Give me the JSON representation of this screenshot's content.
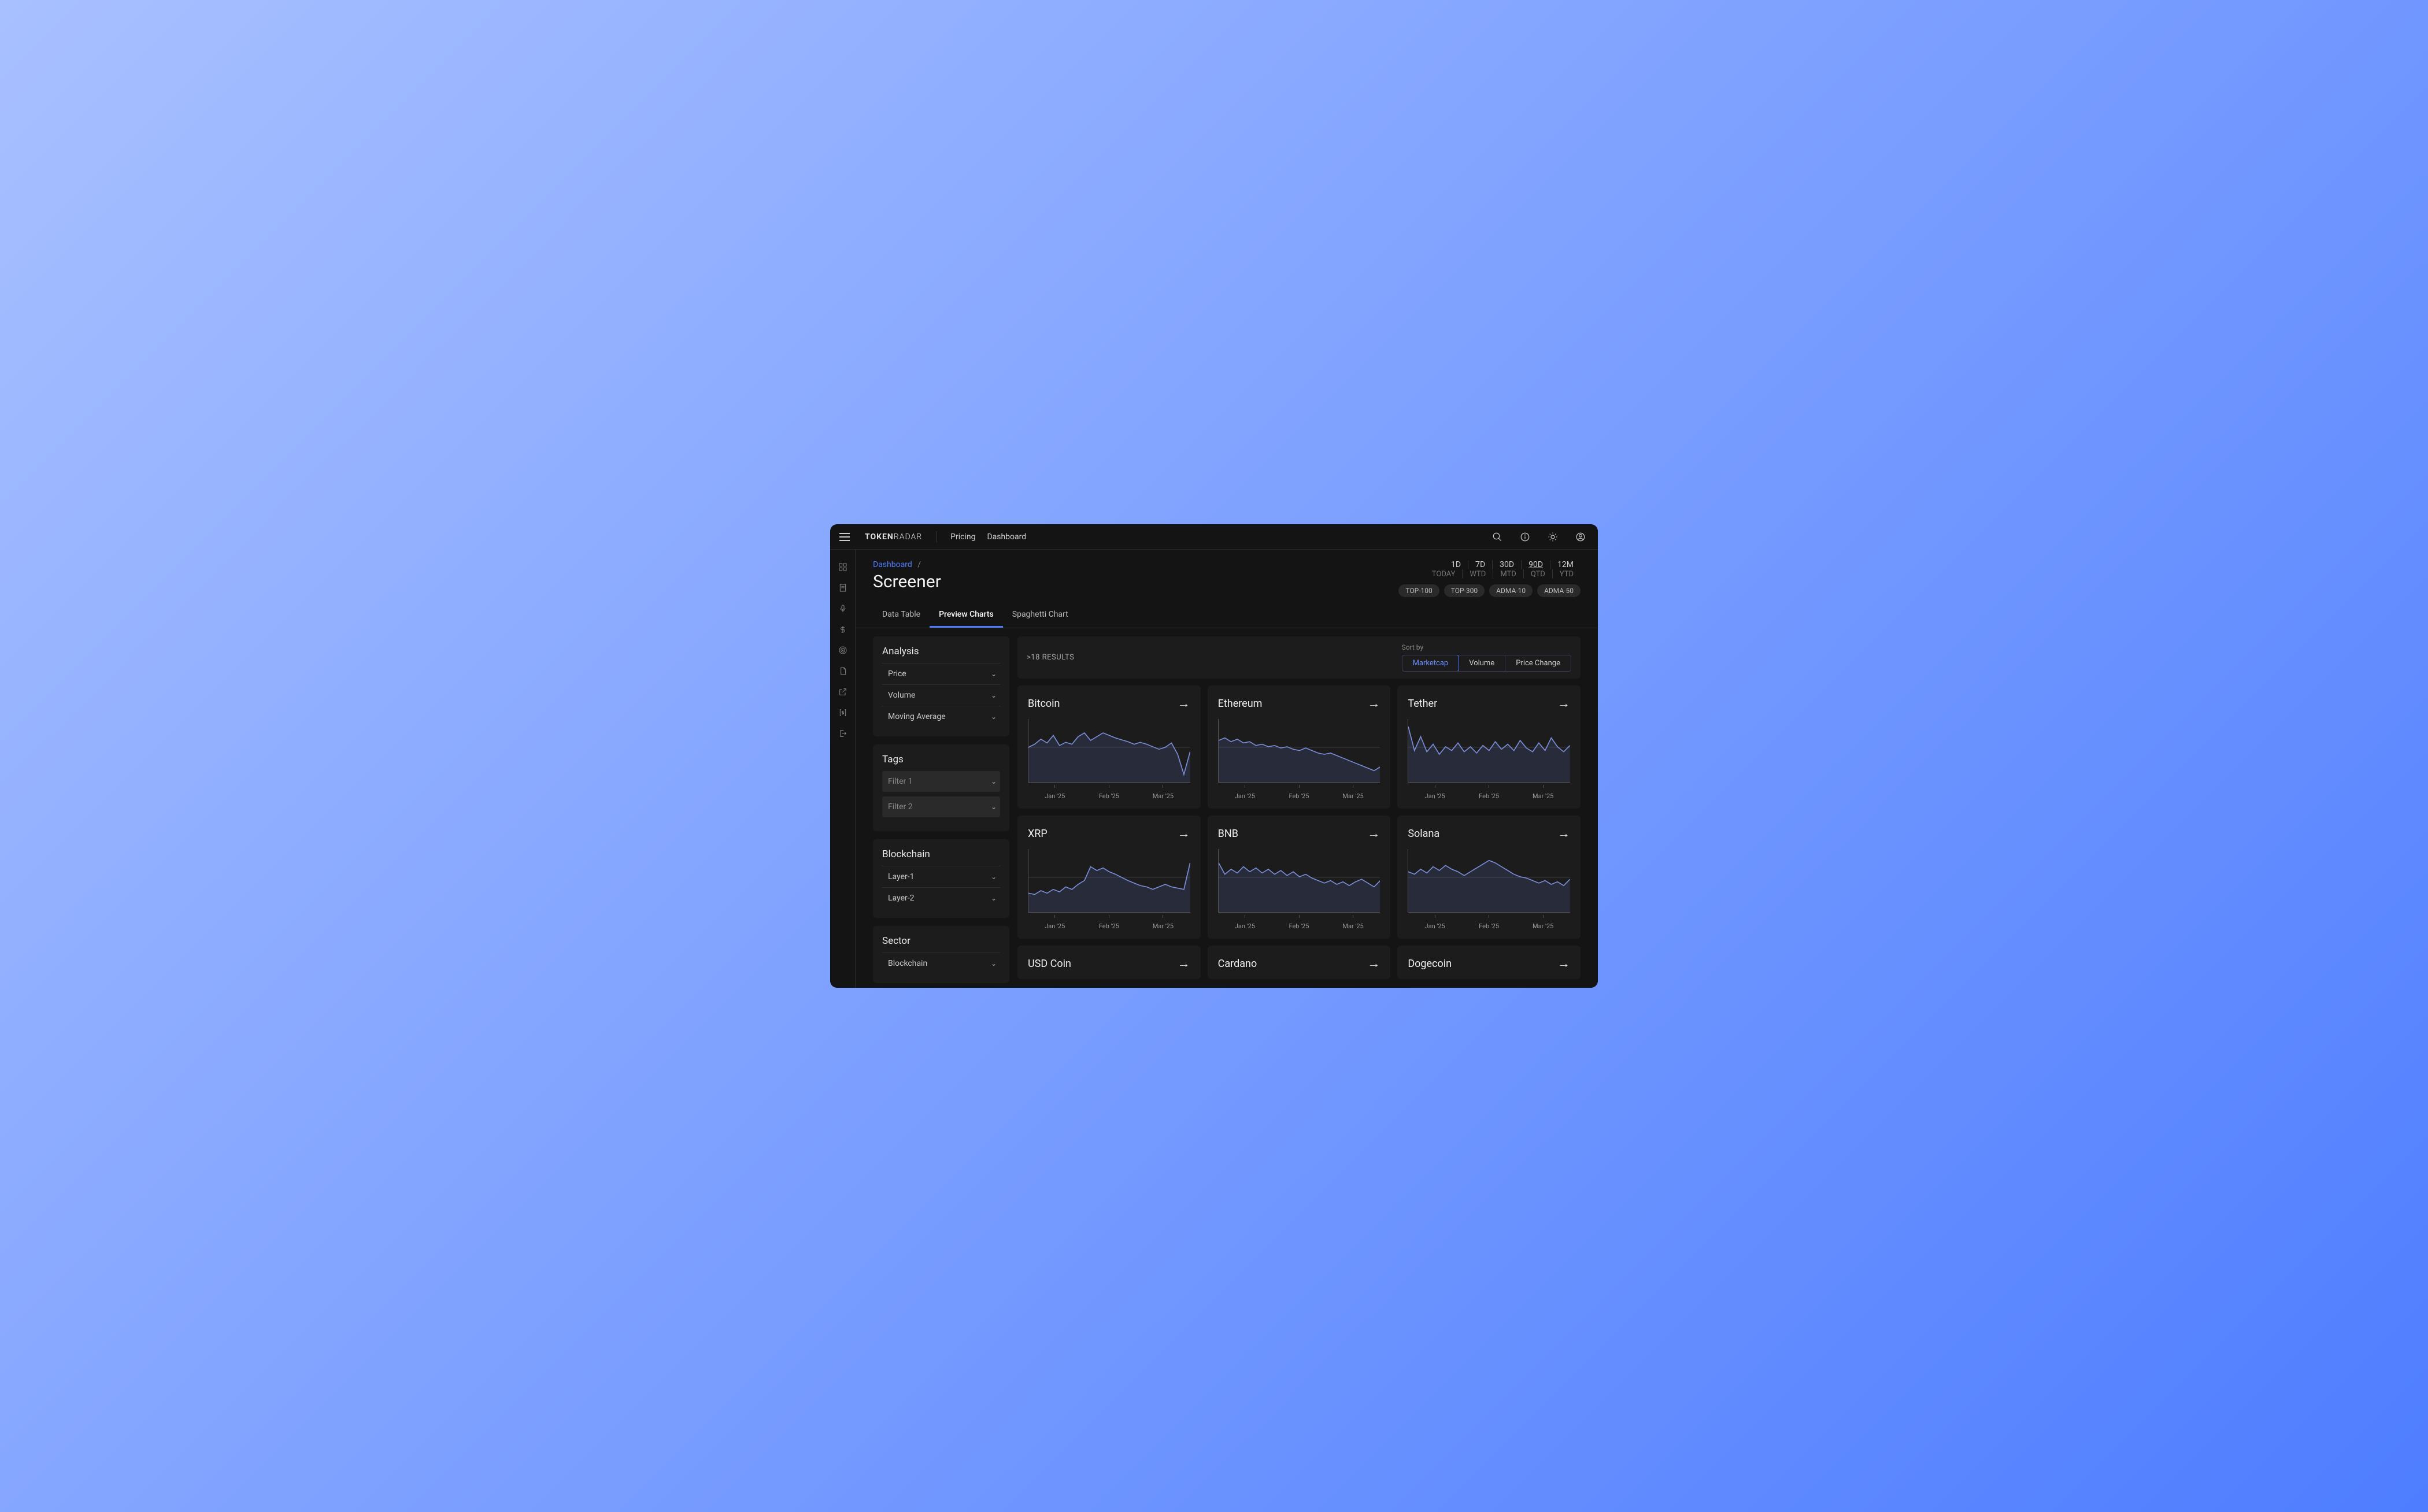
{
  "brand": {
    "strong": "TOKEN",
    "light": "RADAR"
  },
  "nav": {
    "pricing": "Pricing",
    "dashboard": "Dashboard"
  },
  "breadcrumb": {
    "root": "Dashboard",
    "sep": "/"
  },
  "page_title": "Screener",
  "tabs": {
    "data_table": "Data Table",
    "preview_charts": "Preview Charts",
    "spaghetti": "Spaghetti Chart"
  },
  "timeframe_top": [
    "1D",
    "7D",
    "30D",
    "90D",
    "12M"
  ],
  "timeframe_bottom": [
    "TODAY",
    "WTD",
    "MTD",
    "QTD",
    "YTD"
  ],
  "timeframe_active_index": 3,
  "index_chips": [
    "TOP-100",
    "TOP-300",
    "ADMA-10",
    "ADMA-50"
  ],
  "panels": {
    "analysis": {
      "title": "Analysis",
      "items": [
        "Price",
        "Volume",
        "Moving Average"
      ]
    },
    "tags": {
      "title": "Tags",
      "items": [
        "Filter 1",
        "Filter 2"
      ]
    },
    "blockchain": {
      "title": "Blockchain",
      "items": [
        "Layer-1",
        "Layer-2"
      ]
    },
    "sector": {
      "title": "Sector",
      "items": [
        "Blockchain"
      ]
    }
  },
  "results_count": ">18 RESULTS",
  "sort": {
    "label": "Sort by",
    "options": [
      "Marketcap",
      "Volume",
      "Price Change"
    ],
    "active_index": 0
  },
  "axis_labels": [
    "Jan '25",
    "Feb '25",
    "Mar '25"
  ],
  "sidebar_icons": [
    "dashboard-icon",
    "document-icon",
    "mic-icon",
    "dollar-icon",
    "target-icon",
    "page-icon",
    "external-link-icon",
    "bracket-dollar-icon",
    "logout-icon"
  ],
  "cards": [
    {
      "name": "Bitcoin"
    },
    {
      "name": "Ethereum"
    },
    {
      "name": "Tether"
    },
    {
      "name": "XRP"
    },
    {
      "name": "BNB"
    },
    {
      "name": "Solana"
    },
    {
      "name": "USD Coin"
    },
    {
      "name": "Cardano"
    },
    {
      "name": "Dogecoin"
    }
  ],
  "chart_data": [
    {
      "type": "line",
      "name": "Bitcoin",
      "x_labels": [
        "Jan '25",
        "Feb '25",
        "Mar '25"
      ],
      "ylim": [
        0,
        100
      ],
      "values": [
        55,
        60,
        68,
        62,
        74,
        58,
        63,
        60,
        72,
        78,
        66,
        72,
        78,
        74,
        70,
        67,
        64,
        60,
        63,
        60,
        56,
        52,
        55,
        62,
        44,
        12,
        48
      ]
    },
    {
      "type": "line",
      "name": "Ethereum",
      "x_labels": [
        "Jan '25",
        "Feb '25",
        "Mar '25"
      ],
      "ylim": [
        0,
        100
      ],
      "values": [
        66,
        70,
        64,
        68,
        62,
        64,
        58,
        60,
        56,
        58,
        54,
        56,
        52,
        50,
        54,
        50,
        46,
        44,
        46,
        42,
        38,
        34,
        30,
        26,
        22,
        18,
        24
      ]
    },
    {
      "type": "line",
      "name": "Tether",
      "x_labels": [
        "Jan '25",
        "Feb '25",
        "Mar '25"
      ],
      "ylim": [
        0,
        100
      ],
      "values": [
        88,
        50,
        72,
        48,
        60,
        44,
        56,
        50,
        62,
        48,
        56,
        46,
        58,
        50,
        64,
        52,
        60,
        50,
        66,
        54,
        48,
        62,
        50,
        70,
        56,
        48,
        58
      ]
    },
    {
      "type": "line",
      "name": "XRP",
      "x_labels": [
        "Jan '25",
        "Feb '25",
        "Mar '25"
      ],
      "ylim": [
        0,
        100
      ],
      "values": [
        30,
        28,
        34,
        30,
        36,
        32,
        40,
        36,
        44,
        50,
        72,
        66,
        70,
        64,
        60,
        55,
        50,
        46,
        42,
        40,
        36,
        40,
        44,
        40,
        38,
        36,
        78
      ]
    },
    {
      "type": "line",
      "name": "BNB",
      "x_labels": [
        "Jan '25",
        "Feb '25",
        "Mar '25"
      ],
      "ylim": [
        0,
        100
      ],
      "values": [
        78,
        60,
        68,
        62,
        72,
        64,
        70,
        62,
        68,
        60,
        66,
        58,
        64,
        56,
        60,
        54,
        50,
        46,
        50,
        44,
        48,
        42,
        48,
        52,
        46,
        40,
        50
      ]
    },
    {
      "type": "line",
      "name": "Solana",
      "x_labels": [
        "Jan '25",
        "Feb '25",
        "Mar '25"
      ],
      "ylim": [
        0,
        100
      ],
      "values": [
        64,
        60,
        68,
        62,
        72,
        66,
        74,
        68,
        64,
        58,
        64,
        70,
        76,
        82,
        78,
        72,
        66,
        60,
        56,
        54,
        50,
        46,
        50,
        44,
        48,
        42,
        52
      ]
    },
    {
      "type": "line",
      "name": "USD Coin",
      "x_labels": [
        "Jan '25",
        "Feb '25",
        "Mar '25"
      ],
      "ylim": [
        0,
        100
      ],
      "values": []
    },
    {
      "type": "line",
      "name": "Cardano",
      "x_labels": [
        "Jan '25",
        "Feb '25",
        "Mar '25"
      ],
      "ylim": [
        0,
        100
      ],
      "values": []
    },
    {
      "type": "line",
      "name": "Dogecoin",
      "x_labels": [
        "Jan '25",
        "Feb '25",
        "Mar '25"
      ],
      "ylim": [
        0,
        100
      ],
      "values": []
    }
  ]
}
